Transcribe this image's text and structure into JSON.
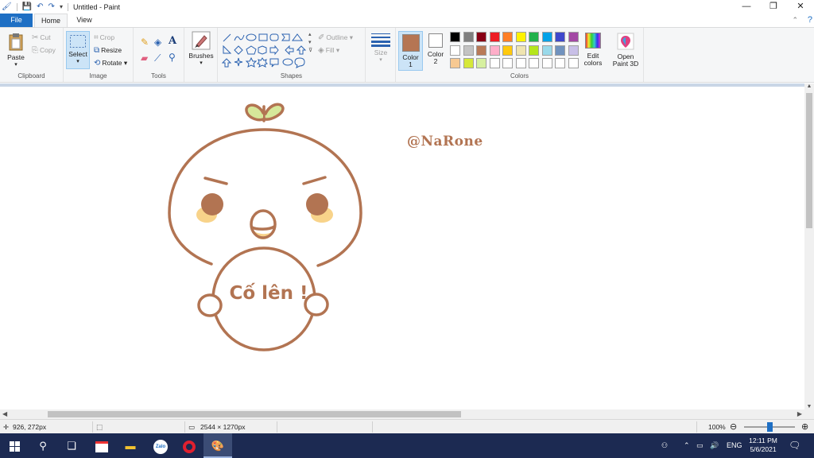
{
  "window": {
    "title": "Untitled - Paint"
  },
  "tabs": {
    "file": "File",
    "home": "Home",
    "view": "View"
  },
  "clipboard": {
    "paste": "Paste",
    "cut": "Cut",
    "copy": "Copy",
    "label": "Clipboard"
  },
  "image": {
    "select": "Select",
    "crop": "Crop",
    "resize": "Resize",
    "rotate": "Rotate",
    "label": "Image"
  },
  "tools": {
    "label": "Tools"
  },
  "brushes": {
    "label": "Brushes"
  },
  "shapes": {
    "outline": "Outline",
    "fill": "Fill",
    "label": "Shapes"
  },
  "size": {
    "label": "Size"
  },
  "colors": {
    "color1_line1": "Color",
    "color1_line2": "1",
    "color2_line1": "Color",
    "color2_line2": "2",
    "edit_line1": "Edit",
    "edit_line2": "colors",
    "label": "Colors",
    "color1_value": "#b57553",
    "color2_value": "#ffffff",
    "palette": [
      "#000000",
      "#7f7f7f",
      "#880015",
      "#ed1c24",
      "#ff7f27",
      "#fff200",
      "#22b14c",
      "#00a2e8",
      "#3f48cc",
      "#a349a4",
      "#ffffff",
      "#c3c3c3",
      "#b97a57",
      "#ffaec9",
      "#ffc90e",
      "#efe4b0",
      "#b5e61d",
      "#99d9ea",
      "#7092be",
      "#c8bfe7",
      "#f7c992",
      "#d6e83a",
      "#d6f0a0",
      "#ffffff",
      "#ffffff",
      "#ffffff",
      "#ffffff",
      "#ffffff",
      "#ffffff",
      "#ffffff"
    ]
  },
  "paint3d": {
    "line1": "Open",
    "line2": "Paint 3D"
  },
  "canvas": {
    "watermark": "@NaRone",
    "speech": "Cố lên !",
    "line_color": "#b27452",
    "cheek_color": "#f8d38a",
    "leaf_color": "#d6e89a"
  },
  "status": {
    "cursor_pos": "926, 272px",
    "canvas_size": "2544 × 1270px",
    "zoom": "100%"
  },
  "taskbar": {
    "lang": "ENG",
    "time": "12:11 PM",
    "date": "5/6/2021"
  }
}
